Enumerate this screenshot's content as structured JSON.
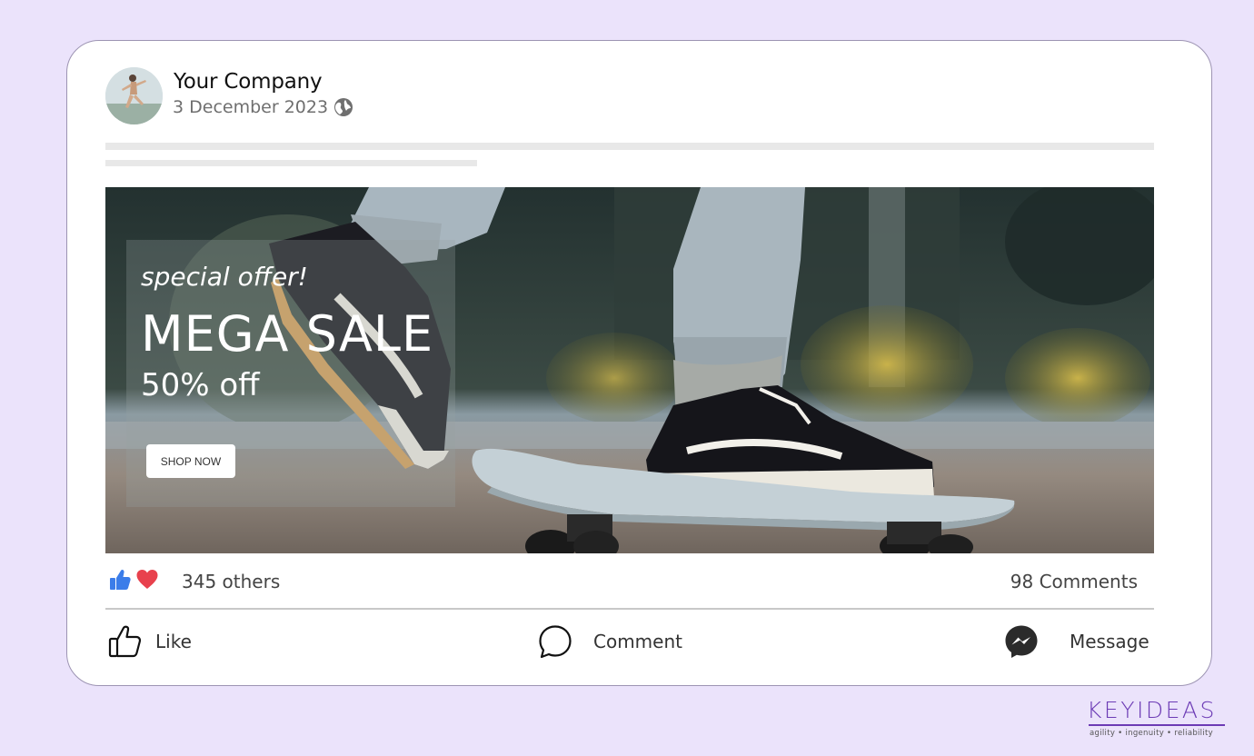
{
  "post": {
    "author": "Your Company",
    "date": "3 December 2023"
  },
  "banner": {
    "tagline": "special offer!",
    "headline": "MEGA SALE",
    "discount": "50% off",
    "cta_label": "SHOP NOW"
  },
  "stats": {
    "reactions_text": "345 others",
    "comments_text": "98 Comments"
  },
  "actions": {
    "like": "Like",
    "comment": "Comment",
    "message": "Message"
  },
  "brand": {
    "logo_word": "KEYIDEAS",
    "logo_tagline": "agility  •  ingenuity  •  reliability"
  },
  "colors": {
    "background": "#ebe3fb",
    "like_blue": "#3b7de9",
    "love_red": "#e8414d",
    "brand_purple": "#6c3bb5"
  },
  "icons": [
    "globe-icon",
    "like-reaction-icon",
    "love-reaction-icon",
    "thumbs-up-icon",
    "comment-bubble-icon",
    "messenger-icon"
  ]
}
